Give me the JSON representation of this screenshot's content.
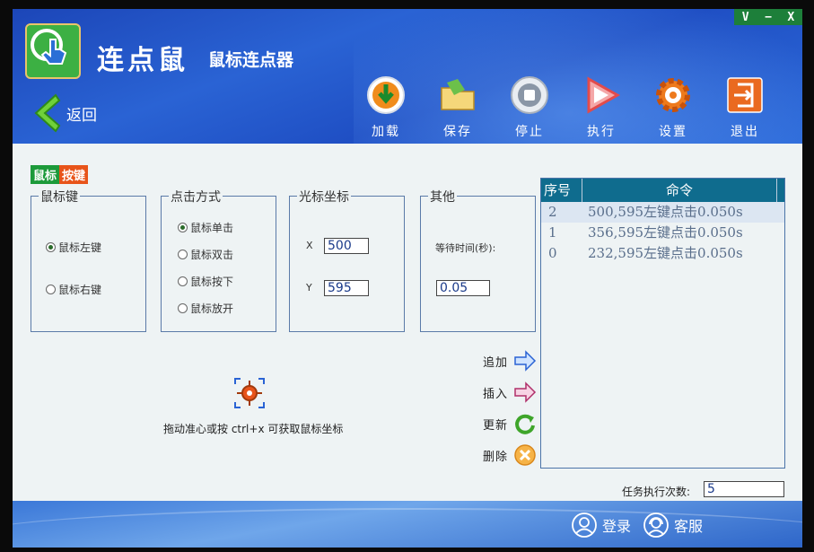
{
  "window_controls": {
    "restore": "V",
    "minimize": "−",
    "close": "X"
  },
  "app": {
    "title": "连点鼠",
    "subtitle": "鼠标连点器"
  },
  "back": {
    "label": "返回"
  },
  "toolbar": {
    "load": "加载",
    "save": "保存",
    "stop": "停止",
    "run": "执行",
    "settings": "设置",
    "exit": "退出"
  },
  "mode_tabs": {
    "mouse": "鼠标",
    "key": "按键"
  },
  "mouse_button": {
    "title": "鼠标键",
    "options": [
      "鼠标左键",
      "鼠标右键"
    ],
    "selected": "鼠标左键"
  },
  "click_mode": {
    "title": "点击方式",
    "options": [
      "鼠标单击",
      "鼠标双击",
      "鼠标按下",
      "鼠标放开"
    ],
    "selected": "鼠标单击"
  },
  "cursor_coords": {
    "title": "光标坐标",
    "x_label": "X",
    "x_value": "500",
    "y_label": "Y",
    "y_value": "595"
  },
  "other": {
    "title": "其他",
    "wait_label": "等待时间(秒):",
    "wait_value": "0.05"
  },
  "crosshair": {
    "hint": "拖动准心或按 ctrl+x 可获取鼠标坐标"
  },
  "command_list": {
    "headers": [
      "序号",
      "命令"
    ],
    "rows": [
      {
        "index": "2",
        "command": "500,595左键点击0.050s"
      },
      {
        "index": "1",
        "command": "356,595左键点击0.050s"
      },
      {
        "index": "0",
        "command": "232,595左键点击0.050s"
      }
    ]
  },
  "actions": {
    "add": "追加",
    "insert": "插入",
    "update": "更新",
    "delete": "删除"
  },
  "repeat": {
    "label": "任务执行次数:",
    "value": "5"
  },
  "footer": {
    "login": "登录",
    "service": "客服"
  },
  "colors": {
    "header_blue": "#2a63d4",
    "list_header": "#0f6c8e",
    "accent_green": "#3cb043",
    "accent_orange": "#e8541a"
  }
}
